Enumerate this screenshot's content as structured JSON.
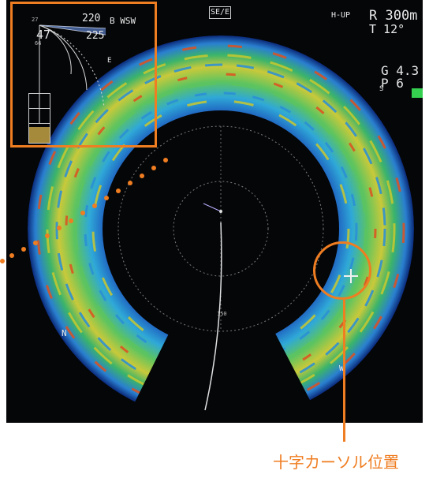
{
  "display": {
    "heading_label": "SE/E",
    "mode": "H-UP",
    "range": "R 300m",
    "tilt": "T 12°",
    "gain": "G 4.3",
    "pulse": "P  6",
    "side_marker_s": "S",
    "marker_n": "N",
    "marker_w": "W",
    "range_mark": "150",
    "colors": {
      "indicator": "#35d050",
      "accent": "#ef7d21",
      "echo_strong": "#e05020",
      "echo_mid": "#c8c830",
      "echo_weak": "#2a8fd8"
    }
  },
  "inset": {
    "bearing": "B  WSW",
    "top_number": "220",
    "side_number": "47",
    "tilt_number": "225",
    "small_top": "27",
    "small_bottom": "66",
    "e_marker": "E"
  },
  "annotation": {
    "callout_label": "十字カーソル位置"
  }
}
